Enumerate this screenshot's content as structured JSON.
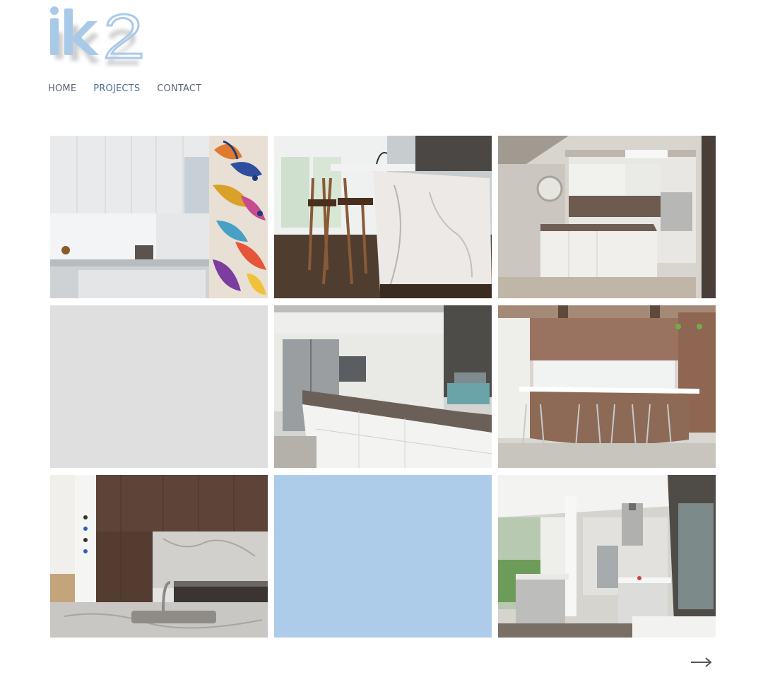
{
  "brand": {
    "logo_text": "ik2"
  },
  "nav": {
    "items": [
      {
        "label": "HOME",
        "active": false
      },
      {
        "label": "PROJECTS",
        "active": true
      },
      {
        "label": "CONTACT",
        "active": false
      }
    ]
  },
  "colors": {
    "logo_blue": "#a9c9e8",
    "nav_text": "#5b6470",
    "nav_active": "#4a6e94",
    "placeholder_gray": "#dfdfe0",
    "placeholder_blue": "#acccea"
  },
  "gallery": {
    "tiles": [
      {
        "name": "kitchen-photo-white-gloss-mural"
      },
      {
        "name": "kitchen-photo-marble-island-stools"
      },
      {
        "name": "kitchen-photo-open-plan-island"
      },
      {
        "name": "placeholder-gray-tile"
      },
      {
        "name": "kitchen-photo-grey-island-fridge"
      },
      {
        "name": "kitchen-photo-timber-curved-bar"
      },
      {
        "name": "kitchen-photo-dark-timber-marble"
      },
      {
        "name": "placeholder-blue-tile"
      },
      {
        "name": "kitchen-photo-pavilion-living"
      }
    ]
  },
  "pagination": {
    "next_icon": "arrow-right-icon",
    "next_glyph": "→"
  }
}
